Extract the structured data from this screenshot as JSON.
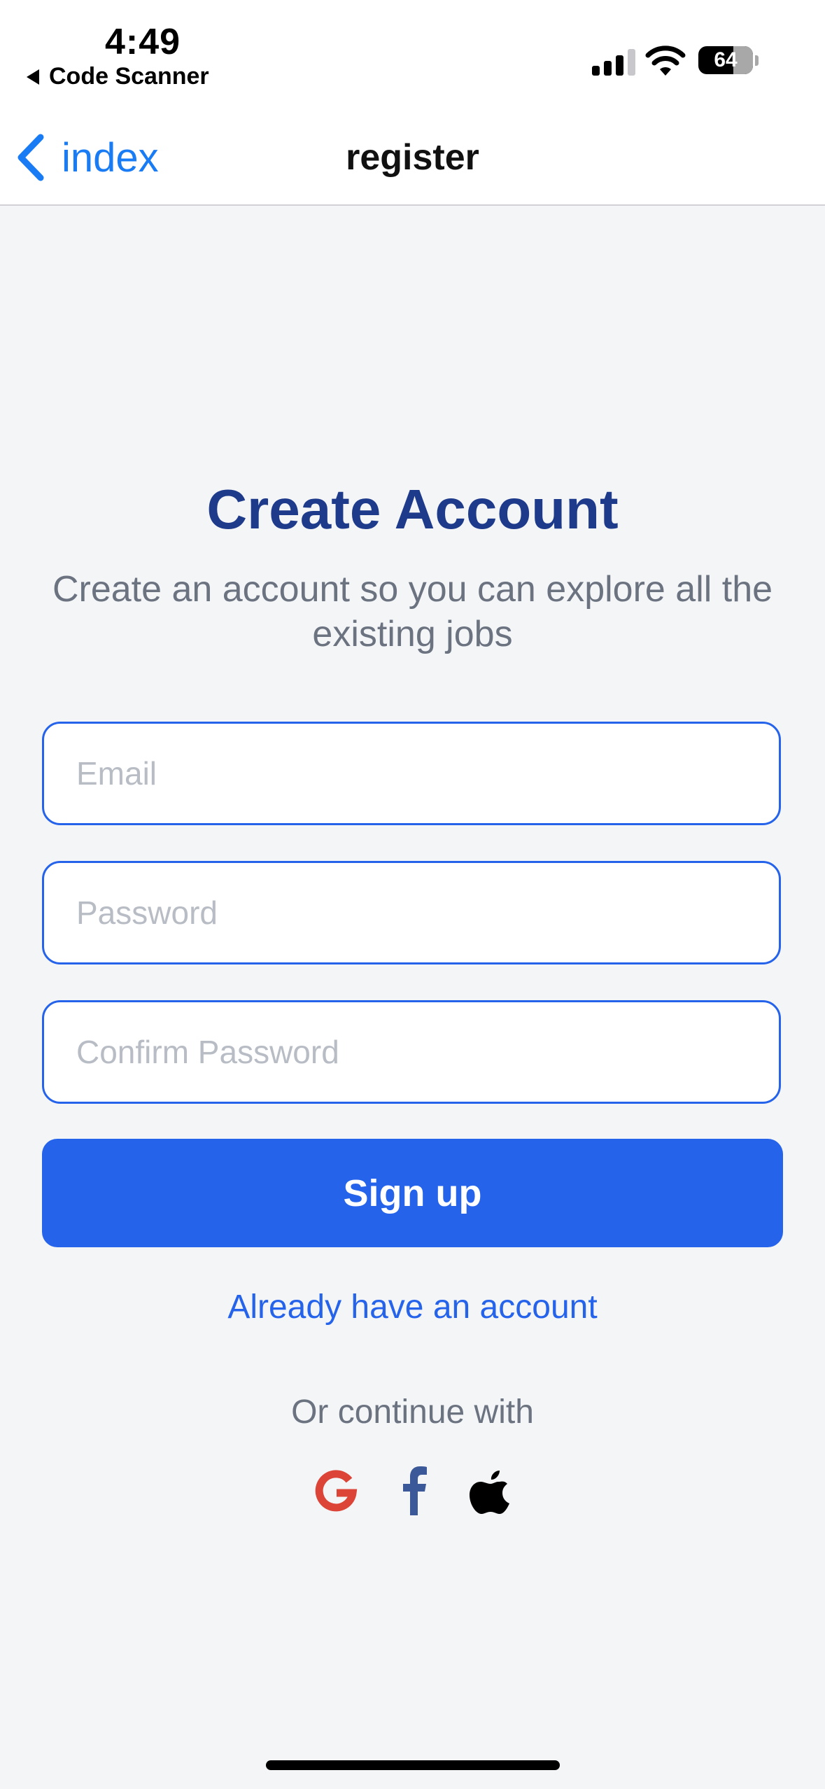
{
  "status_bar": {
    "time": "4:49",
    "back_app": "Code Scanner",
    "battery": "64"
  },
  "nav": {
    "back_label": "index",
    "title": "register"
  },
  "main": {
    "heading": "Create Account",
    "subheading": "Create an account so you can explore all the existing jobs",
    "email_placeholder": "Email",
    "password_placeholder": "Password",
    "confirm_placeholder": "Confirm Password",
    "signup_label": "Sign up",
    "already_label": "Already have an account",
    "continue_label": "Or continue with"
  },
  "social": {
    "icons": [
      "google-icon",
      "facebook-icon",
      "apple-icon"
    ]
  },
  "colors": {
    "primary": "#2563EB",
    "heading": "#1E3A8A",
    "nav_link": "#1A7CF4",
    "background": "#F4F5F7",
    "muted_text": "#6B7280",
    "google": "#DB4437",
    "facebook": "#3B5998"
  }
}
